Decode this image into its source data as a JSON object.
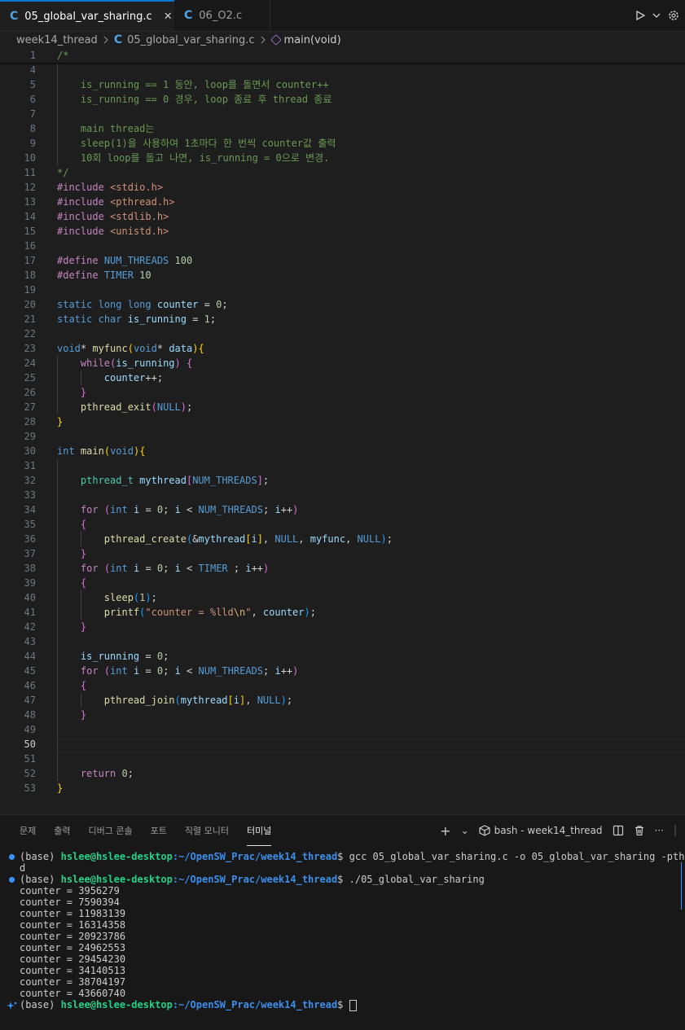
{
  "tabs": [
    {
      "icon": "C",
      "label": "05_global_var_sharing.c",
      "close": "✕"
    },
    {
      "icon": "C",
      "label": "06_O2.c"
    }
  ],
  "breadcrumb": {
    "folder": "week14_thread",
    "file": "05_global_var_sharing.c",
    "symbol": "main(void)"
  },
  "editor": {
    "ln": {
      "1": "1",
      "4": "4",
      "5": "5",
      "6": "6",
      "7": "7",
      "8": "8",
      "9": "9",
      "10": "10",
      "11": "11",
      "12": "12",
      "13": "13",
      "14": "14",
      "15": "15",
      "16": "16",
      "17": "17",
      "18": "18",
      "19": "19",
      "20": "20",
      "21": "21",
      "22": "22",
      "23": "23",
      "24": "24",
      "25": "25",
      "26": "26",
      "27": "27",
      "28": "28",
      "29": "29",
      "30": "30",
      "31": "31",
      "32": "32",
      "33": "33",
      "34": "34",
      "35": "35",
      "36": "36",
      "37": "37",
      "38": "38",
      "39": "39",
      "40": "40",
      "41": "41",
      "42": "42",
      "43": "43",
      "44": "44",
      "45": "45",
      "46": "46",
      "47": "47",
      "48": "48",
      "49": "49",
      "50": "50",
      "51": "51",
      "52": "52",
      "53": "53"
    },
    "code": {
      "l1": "/*",
      "l5": "    is_running == 1 동안, loop를 돌면서 counter++",
      "l6": "    is_running == 0 경우, loop 종료 후 thread 종료",
      "l8": "    main thread는",
      "l9": "    sleep(1)을 사용하여 1초마다 한 번씩 counter값 출력",
      "l10": "    10회 loop를 돌고 나면, is_running = 0으로 변경.",
      "l11": "*/",
      "inc": "#include",
      "l12h": "<stdio.h>",
      "l13h": "<pthread.h>",
      "l14h": "<stdlib.h>",
      "l15h": "<unistd.h>",
      "define": "#define",
      "l17n": "NUM_THREADS",
      "l17v": "100",
      "l18n": "TIMER",
      "l18v": "10",
      "static": "static",
      "long": "long",
      "char": "char",
      "void": "void",
      "int": "int",
      "counter": "counter",
      "is_running": "is_running",
      "zero": "0",
      "one": "1",
      "myfunc": "myfunc",
      "data": "data",
      "while": "while",
      "pthread_exit": "pthread_exit",
      "NULL": "NULL",
      "main": "main",
      "pthread_t": "pthread_t",
      "mythread": "mythread",
      "for": "for",
      "i": "i",
      "pthread_create": "pthread_create",
      "sleep": "sleep",
      "printf": "printf",
      "str_a": "\"counter = %lld",
      "str_esc": "\\n",
      "str_b": "\"",
      "pthread_join": "pthread_join",
      "return": "return"
    }
  },
  "panel": {
    "tabs": [
      "문제",
      "출력",
      "디버그 콘솔",
      "포트",
      "직렬 모니터",
      "터미널"
    ],
    "add": "+",
    "chevron": "⌄",
    "shell": "bash - week14_thread",
    "more": "···"
  },
  "terminal": {
    "base": "(base)",
    "user": "hslee@hslee-desktop",
    "path": ":~/OpenSW_Prac/week14_thread",
    "dollar": "$",
    "cmd1": " gcc 05_global_var_sharing.c -o 05_global_var_sharing -pthrea",
    "cmd1_wrap": "d",
    "cmd2": " ./05_global_var_sharing",
    "outputs": [
      "counter = 3956279",
      "counter = 7590394",
      "counter = 11983139",
      "counter = 16314358",
      "counter = 20923786",
      "counter = 24962553",
      "counter = 29454230",
      "counter = 34140513",
      "counter = 38704197",
      "counter = 43660740"
    ]
  },
  "colors": {
    "accent": "#0078d4",
    "prompt_user": "#23d18b",
    "prompt_path": "#3b8eea",
    "status_dot": "#3794ff"
  }
}
